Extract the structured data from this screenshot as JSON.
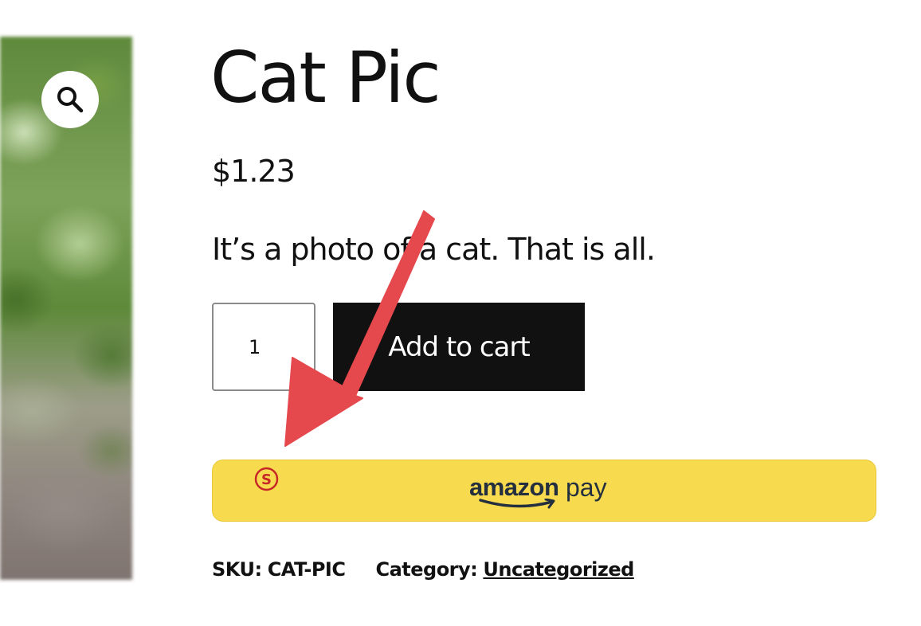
{
  "product": {
    "title": "Cat Pic",
    "price": "$1.23",
    "description": "It’s a photo of a cat. That is all.",
    "quantity": "1",
    "add_to_cart_label": "Add to cart"
  },
  "amazon_pay": {
    "logo_amazon": "amazon",
    "logo_pay": "pay"
  },
  "meta": {
    "sku_label": "SKU:",
    "sku_value": "CAT-PIC",
    "category_label": "Category:",
    "category_value": "Uncategorized"
  },
  "icons": {
    "zoom": "search-icon",
    "sezzle": "sezzle-s-icon",
    "annotation": "red-arrow-annotation"
  },
  "colors": {
    "add_to_cart_bg": "#111111",
    "amazon_pay_bg": "#f7da4d",
    "amazon_text": "#232f3e",
    "amazon_smile": "#f90",
    "annotation_red": "#e5484d",
    "sezzle_red": "#c62828"
  }
}
